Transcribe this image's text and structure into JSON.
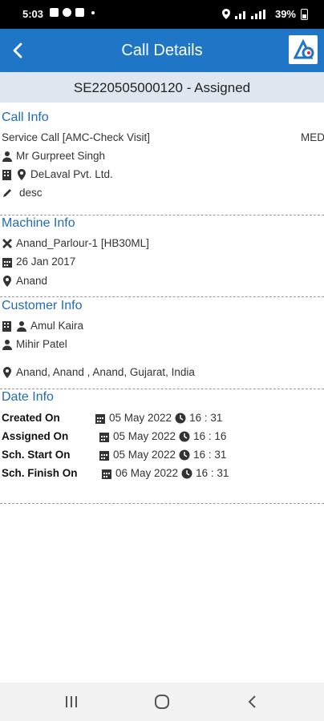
{
  "status_bar": {
    "time": "5:03",
    "battery": "39%"
  },
  "app_bar": {
    "title": "Call Details"
  },
  "call_header": "SE220505000120 - Assigned",
  "call_info": {
    "title": "Call Info",
    "service_type": "Service Call [AMC-Check Visit]",
    "priority": "MED",
    "contact": "Mr Gurpreet Singh",
    "company": "DeLaval Pvt. Ltd.",
    "description": "desc"
  },
  "machine_info": {
    "title": "Machine Info",
    "machine": "Anand_Parlour-1 [HB30ML]",
    "date": "26 Jan 2017",
    "location": "Anand"
  },
  "customer_info": {
    "title": "Customer Info",
    "customer": "Amul Kaira",
    "person": "Mihir Patel",
    "address": "Anand, Anand , Anand, Gujarat, India"
  },
  "date_info": {
    "title": "Date Info",
    "rows": [
      {
        "label": "Created On",
        "date": "05 May 2022",
        "time": "16 : 31"
      },
      {
        "label": "Assigned On",
        "date": "05 May 2022",
        "time": "16 : 16"
      },
      {
        "label": "Sch. Start On",
        "date": "05 May 2022",
        "time": "16 : 31"
      },
      {
        "label": "Sch. Finish On",
        "date": "06 May 2022",
        "time": "16 : 31"
      }
    ]
  },
  "colors": {
    "app_bar": "#1f76c6",
    "section_title": "#1f6bb5",
    "sub_header_bg": "#dfe6ef"
  },
  "icons": [
    "back-arrow-icon",
    "app-logo-icon",
    "person-icon",
    "building-icon",
    "location-pin-icon",
    "pencil-icon",
    "tools-icon",
    "calendar-icon",
    "clock-icon",
    "nav-recents-icon",
    "nav-home-icon",
    "nav-back-icon"
  ]
}
